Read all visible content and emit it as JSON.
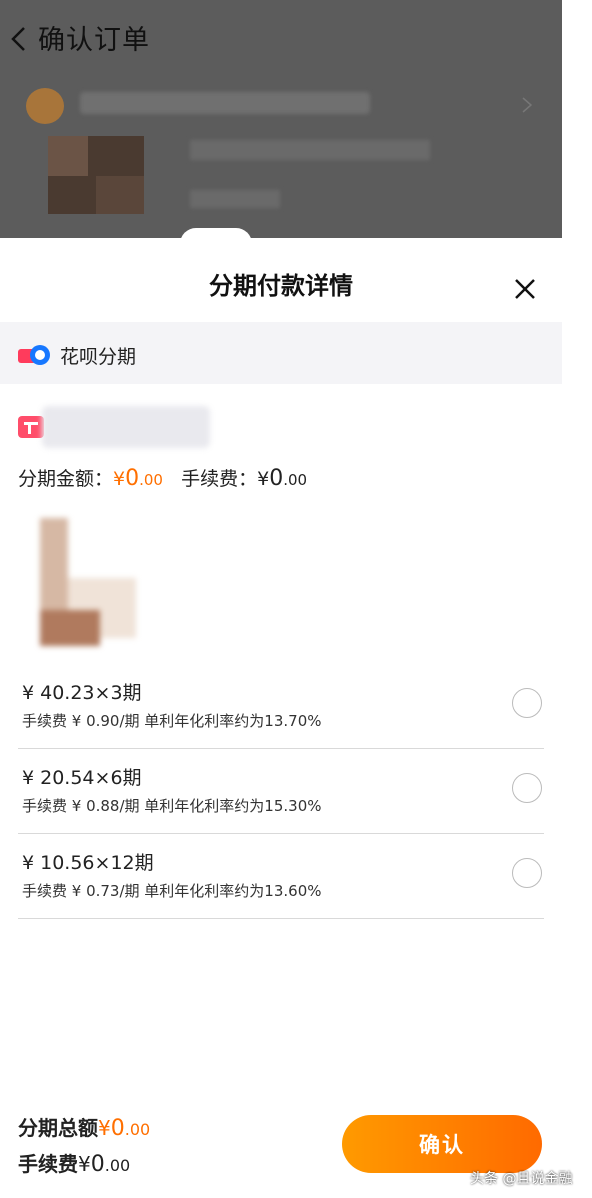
{
  "background": {
    "title": "确认订单"
  },
  "sheet": {
    "title": "分期付款详情",
    "method_label": "花呗分期",
    "amount_label": "分期金额：",
    "amount_currency": "¥",
    "amount_int": "0",
    "amount_dec": ".00",
    "fee_label": "手续费：",
    "fee_currency": "¥",
    "fee_int": "0",
    "fee_dec": ".00"
  },
  "plans": [
    {
      "main": "¥ 40.23×3期",
      "sub": "手续费 ¥ 0.90/期 单利年化利率约为13.70%"
    },
    {
      "main": "¥ 20.54×6期",
      "sub": "手续费 ¥ 0.88/期 单利年化利率约为15.30%"
    },
    {
      "main": "¥ 10.56×12期",
      "sub": "手续费 ¥ 0.73/期 单利年化利率约为13.60%"
    }
  ],
  "footer": {
    "total_label": "分期总额",
    "total_currency": "¥",
    "total_int": "0",
    "total_dec": ".00",
    "fee_label": "手续费",
    "fee_currency": "¥",
    "fee_int": "0",
    "fee_dec": ".00",
    "confirm_label": "确认"
  },
  "watermark": "头条 @且说金融",
  "colors": {
    "accent": "#ff6f00",
    "button_start": "#ff9a00",
    "button_end": "#ff6a00"
  }
}
